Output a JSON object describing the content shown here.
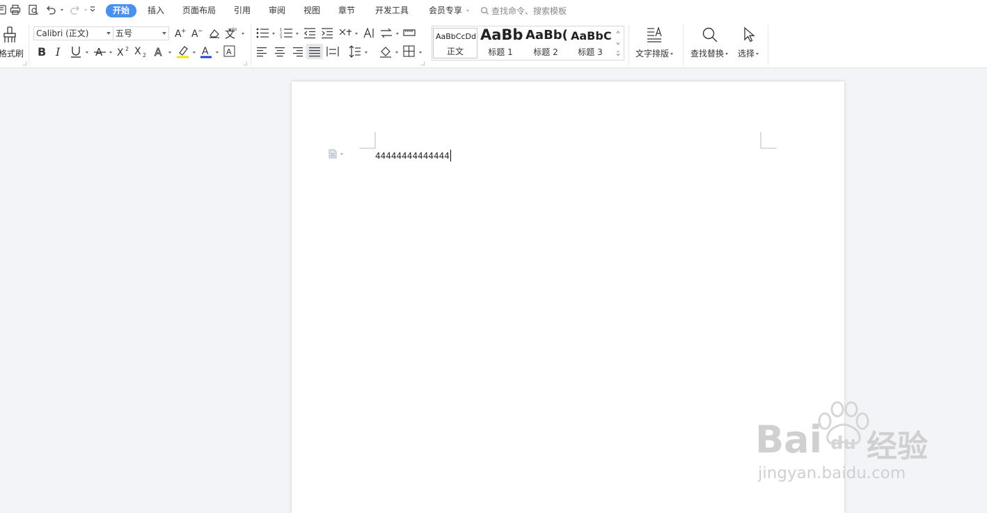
{
  "menu_tabs": {
    "home": "开始",
    "insert": "插入",
    "page_layout": "页面布局",
    "references": "引用",
    "review": "审阅",
    "view": "视图",
    "chapter": "章节",
    "developer": "开发工具",
    "member": "会员专享"
  },
  "search": {
    "placeholder": "查找命令、搜索模板"
  },
  "ribbon": {
    "format_painter": "格式刷",
    "font_name": "Calibri (正文)",
    "font_size": "五号",
    "styles": [
      {
        "sample": "AaBbCcDd",
        "name": "正文"
      },
      {
        "sample": "AaBb",
        "name": "标题 1"
      },
      {
        "sample": "AaBb(",
        "name": "标题 2"
      },
      {
        "sample": "AaBbC(",
        "name": "标题 3"
      }
    ],
    "text_layout": "文字排版",
    "find_replace": "查找替换",
    "select": "选择"
  },
  "document": {
    "body_text": "44444444444444"
  },
  "watermark": {
    "brand": "Bai",
    "brand2": "du",
    "brand_cn": "经验",
    "url": "jingyan.baidu.com"
  },
  "colors": {
    "accent": "#4a90f0",
    "highlight": "#f5e100",
    "font_color": "#1a3fe0"
  }
}
